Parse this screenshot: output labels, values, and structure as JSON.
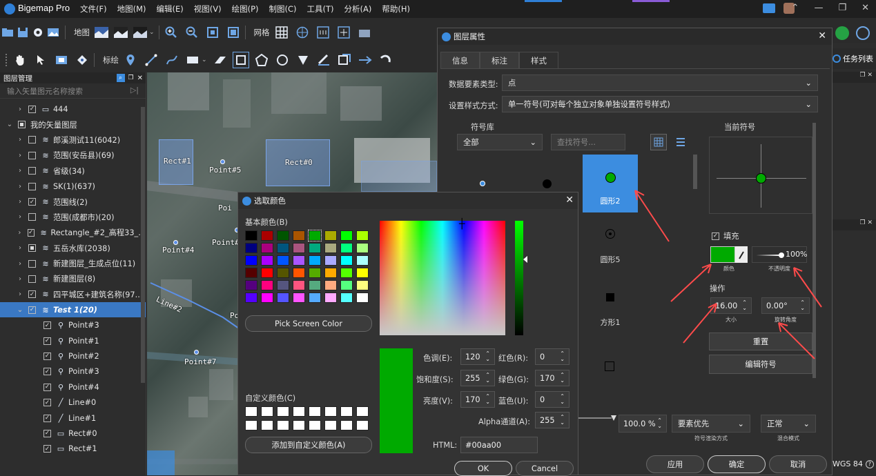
{
  "app": {
    "title": "Bigemap Pro"
  },
  "menu": [
    "文件(F)",
    "地图(M)",
    "编辑(E)",
    "视图(V)",
    "绘图(P)",
    "制图(C)",
    "工具(T)",
    "分析(A)",
    "帮助(H)"
  ],
  "toolbar1": {
    "map_label": "地图",
    "grid_label": "网格"
  },
  "toolbar2": {
    "draw_label": "标绘",
    "tasks_label": "任务列表"
  },
  "layer_panel": {
    "title": "图层管理",
    "search_placeholder": "输入矢量图元名称搜索",
    "rows": [
      {
        "name": "444",
        "indent": 1,
        "arrow": "›",
        "checked": true,
        "icon": "▭"
      },
      {
        "name": "我的矢量图层",
        "indent": 0,
        "arrow": "⌄",
        "checked": "partial",
        "icon": ""
      },
      {
        "name": "郎溪测试11(6042)",
        "indent": 1,
        "arrow": "›",
        "checked": false,
        "icon": "≋"
      },
      {
        "name": "范围(安岳县)(69)",
        "indent": 1,
        "arrow": "›",
        "checked": false,
        "icon": "≋"
      },
      {
        "name": "省级(34)",
        "indent": 1,
        "arrow": "›",
        "checked": false,
        "icon": "≋"
      },
      {
        "name": "SK(1)(637)",
        "indent": 1,
        "arrow": "›",
        "checked": false,
        "icon": "≋"
      },
      {
        "name": "范围线(2)",
        "indent": 1,
        "arrow": "›",
        "checked": true,
        "icon": "≋"
      },
      {
        "name": "范围(成都市)(20)",
        "indent": 1,
        "arrow": "›",
        "checked": false,
        "icon": "≋"
      },
      {
        "name": "Rectangle_#2_高程33_...",
        "indent": 1,
        "arrow": "›",
        "checked": true,
        "icon": "≋"
      },
      {
        "name": "五岳水库(2038)",
        "indent": 1,
        "arrow": "›",
        "checked": "partial",
        "icon": "≋"
      },
      {
        "name": "新建图层_生成点位(11)",
        "indent": 1,
        "arrow": "›",
        "checked": false,
        "icon": "≋"
      },
      {
        "name": "新建图层(8)",
        "indent": 1,
        "arrow": "›",
        "checked": false,
        "icon": "≋"
      },
      {
        "name": "四平城区+建筑名称(97...",
        "indent": 1,
        "arrow": "›",
        "checked": true,
        "icon": "≋"
      },
      {
        "name": "Test 1(20)",
        "indent": 1,
        "arrow": "⌄",
        "checked": true,
        "icon": "≋",
        "selected": true
      },
      {
        "name": "Point#3",
        "indent": 2,
        "arrow": "",
        "checked": true,
        "icon": "⚲"
      },
      {
        "name": "Point#1",
        "indent": 2,
        "arrow": "",
        "checked": true,
        "icon": "⚲"
      },
      {
        "name": "Point#2",
        "indent": 2,
        "arrow": "",
        "checked": true,
        "icon": "⚲"
      },
      {
        "name": "Point#3",
        "indent": 2,
        "arrow": "",
        "checked": true,
        "icon": "⚲"
      },
      {
        "name": "Point#4",
        "indent": 2,
        "arrow": "",
        "checked": true,
        "icon": "⚲"
      },
      {
        "name": "Line#0",
        "indent": 2,
        "arrow": "",
        "checked": true,
        "icon": "╱"
      },
      {
        "name": "Line#1",
        "indent": 2,
        "arrow": "",
        "checked": true,
        "icon": "╱"
      },
      {
        "name": "Rect#0",
        "indent": 2,
        "arrow": "",
        "checked": true,
        "icon": "▭"
      },
      {
        "name": "Rect#1",
        "indent": 2,
        "arrow": "",
        "checked": true,
        "icon": "▭"
      }
    ]
  },
  "map": {
    "labels": [
      "Rect#1",
      "Point#5",
      "Rect#0",
      "Point#4",
      "Point#3",
      "Line#2",
      "Point#7",
      "Poi",
      "Po"
    ]
  },
  "layer_props": {
    "title": "图层属性",
    "tabs": [
      "信息",
      "标注",
      "样式"
    ],
    "active_tab": "样式",
    "feature_type_label": "数据要素类型:",
    "feature_type_value": "点",
    "style_mode_label": "设置样式方式:",
    "style_mode_value": "单一符号(可对每个独立对象单独设置符号样式)",
    "symbol_lib": {
      "title": "符号库",
      "category": "全部",
      "search_placeholder": "查找符号...",
      "items": [
        {
          "label": "",
          "shape": "small-dot"
        },
        {
          "label": "",
          "shape": "big-dot"
        },
        {
          "label": "圆形2",
          "shape": "green-circle",
          "selected": true
        },
        {
          "label": "",
          "shape": ""
        },
        {
          "label": "",
          "shape": ""
        },
        {
          "label": "圆形5",
          "shape": "ring-dot"
        },
        {
          "label": "",
          "shape": ""
        },
        {
          "label": "",
          "shape": ""
        },
        {
          "label": "方形1",
          "shape": "square"
        }
      ]
    },
    "current_symbol": {
      "title": "当前符号",
      "fill_label": "填充",
      "fill_checked": true,
      "color_caption": "颜色",
      "opacity_value": "100%",
      "opacity_caption": "不透明度",
      "operation_label": "操作",
      "size_value": "16.00",
      "size_caption": "大小",
      "angle_value": "0.00°",
      "angle_caption": "旋转角度",
      "reset_button": "重置",
      "edit_button": "编辑符号",
      "fill_color": "#00aa00"
    },
    "render": {
      "opacity": "100.0 %",
      "order": "要素优先",
      "order_caption": "符号渲染方式",
      "blend": "正常",
      "blend_caption": "混合模式"
    },
    "apply_button": "应用",
    "ok_button": "确定",
    "cancel_button": "取消",
    "status_crs": "WGS 84"
  },
  "color_dialog": {
    "title": "选取颜色",
    "basic_colors_label": "基本颜色(B)",
    "basic_colors": [
      "#000000",
      "#aa0000",
      "#005500",
      "#aa5500",
      "#00aa00",
      "#aaaa00",
      "#00ff00",
      "#aaff00",
      "#00007f",
      "#aa007f",
      "#00557f",
      "#aa557f",
      "#00aa7f",
      "#aaaa7f",
      "#00ff7f",
      "#aaff7f",
      "#0000ff",
      "#aa00ff",
      "#0055ff",
      "#aa55ff",
      "#00aaff",
      "#aaaaff",
      "#00ffff",
      "#aaffff",
      "#550000",
      "#ff0000",
      "#555500",
      "#ff5500",
      "#55aa00",
      "#ffaa00",
      "#55ff00",
      "#ffff00",
      "#55007f",
      "#ff007f",
      "#55557f",
      "#ff557f",
      "#55aa7f",
      "#ffaa7f",
      "#55ff7f",
      "#ffff7f",
      "#5500ff",
      "#ff00ff",
      "#5555ff",
      "#ff55ff",
      "#55aaff",
      "#ffaaff",
      "#55ffff",
      "#ffffff"
    ],
    "pick_screen_button": "Pick Screen Color",
    "custom_colors_label": "自定义颜色(C)",
    "add_custom_button": "添加到自定义颜色(A)",
    "current_color": "#00aa00",
    "hue_label": "色调(E):",
    "hue": "120",
    "sat_label": "饱和度(S):",
    "sat": "255",
    "val_label": "亮度(V):",
    "val": "170",
    "red_label": "红色(R):",
    "red": "0",
    "green_label": "绿色(G):",
    "green": "170",
    "blue_label": "蓝色(U):",
    "blue": "0",
    "alpha_label": "Alpha通道(A):",
    "alpha": "255",
    "html_label": "HTML:",
    "html": "#00aa00",
    "ok_button": "OK",
    "cancel_button": "Cancel"
  }
}
